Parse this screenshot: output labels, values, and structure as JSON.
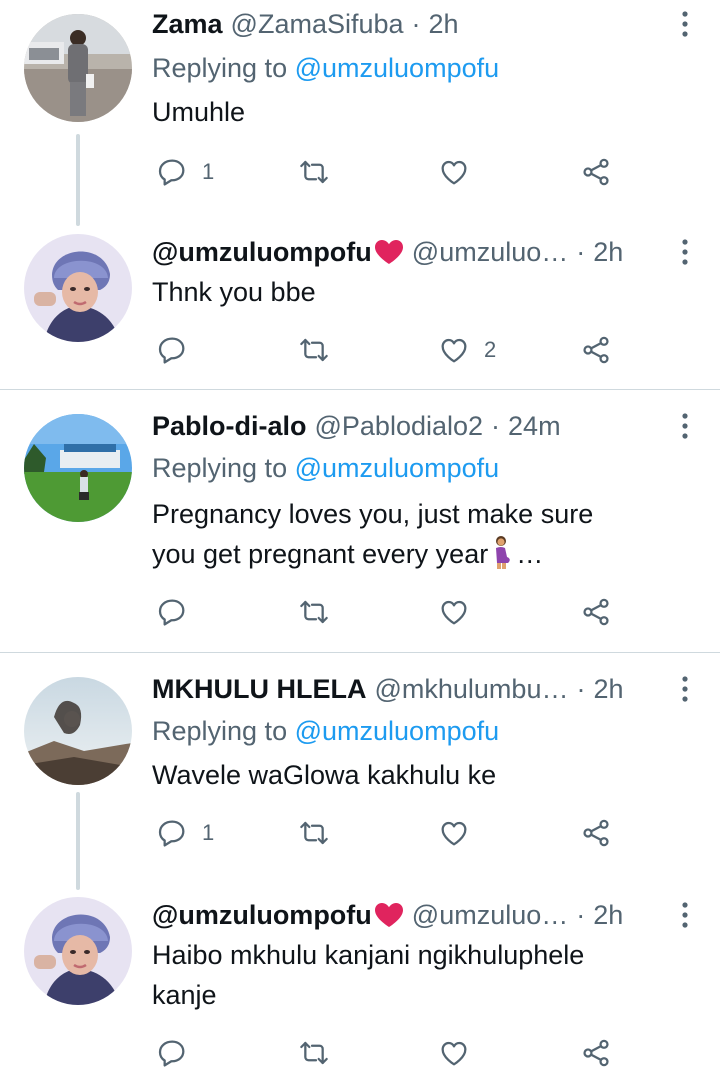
{
  "tweets": [
    {
      "name": "Zama",
      "handle": "@ZamaSifuba",
      "time": "2h",
      "replying_label": "Replying to",
      "replying_mention": "@umzuluompofu",
      "text": "Umuhle",
      "reply_count": "1",
      "retweet_count": "",
      "like_count": ""
    },
    {
      "name": "@umzuluompofu",
      "handle": "@umzuluo…",
      "time": "2h",
      "text": "Thnk you bbe",
      "reply_count": "",
      "retweet_count": "",
      "like_count": "2"
    },
    {
      "name": "Pablo-di-alo",
      "handle": "@Pablodialo2",
      "time": "24m",
      "replying_label": "Replying to",
      "replying_mention": "@umzuluompofu",
      "text_line1": "Pregnancy loves you, just make sure",
      "text_line2": "you get pregnant every year",
      "text_ellipsis": "…",
      "reply_count": "",
      "retweet_count": "",
      "like_count": ""
    },
    {
      "name": "MKHULU HLELA",
      "handle": "@mkhulumbu…",
      "time": "2h",
      "replying_label": "Replying to",
      "replying_mention": "@umzuluompofu",
      "text": "Wavele waGlowa kakhulu ke",
      "reply_count": "1",
      "retweet_count": "",
      "like_count": ""
    },
    {
      "name": "@umzuluompofu",
      "handle": "@umzuluo…",
      "time": "2h",
      "text_line1": "Haibo mkhulu kanjani ngikhuluphele",
      "text_line2": "kanje",
      "reply_count": "",
      "retweet_count": "",
      "like_count": ""
    }
  ],
  "separator": "·",
  "icons": {
    "reply": "reply-icon",
    "retweet": "retweet-icon",
    "like": "like-icon",
    "share": "share-icon",
    "more": "more-options-icon"
  },
  "colors": {
    "text_primary": "#0f1419",
    "text_secondary": "#536471",
    "accent": "#1d9bf0",
    "divider": "#cfd9de",
    "heart_emoji": "#e0245e"
  }
}
